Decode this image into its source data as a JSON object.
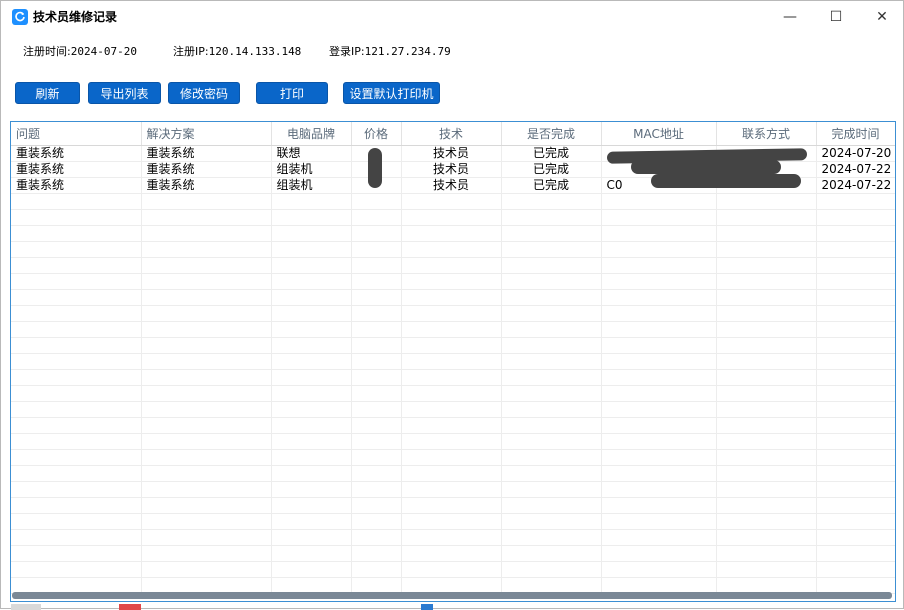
{
  "window": {
    "title": "技术员维修记录",
    "icon": "refresh-icon"
  },
  "controls": {
    "minimize": "—",
    "maximize": "☐",
    "close": "✕"
  },
  "info": {
    "reg_time_label": "注册时间:",
    "reg_time": "2024-07-20",
    "reg_ip_label": "注册IP:",
    "reg_ip": "120.14.133.148",
    "login_ip_label": "登录IP:",
    "login_ip": "121.27.234.79"
  },
  "toolbar": {
    "refresh": "刷新",
    "export": "导出列表",
    "change_password": "修改密码",
    "print": "打印",
    "set_default_printer": "设置默认打印机"
  },
  "table": {
    "headers": [
      "问题",
      "解决方案",
      "电脑品牌",
      "价格",
      "技术",
      "是否完成",
      "MAC地址",
      "联系方式",
      "完成时间"
    ],
    "rows": [
      [
        "重装系统",
        "重装系统",
        "联想",
        "",
        "技术员",
        "已完成",
        "",
        "",
        "2024-07-20"
      ],
      [
        "重装系统",
        "重装系统",
        "组装机",
        "",
        "技术员",
        "已完成",
        "",
        "",
        "2024-07-22"
      ],
      [
        "重装系统",
        "重装系统",
        "组装机",
        "",
        "技术员",
        "已完成",
        "C0",
        "",
        "2024-07-22"
      ]
    ]
  }
}
